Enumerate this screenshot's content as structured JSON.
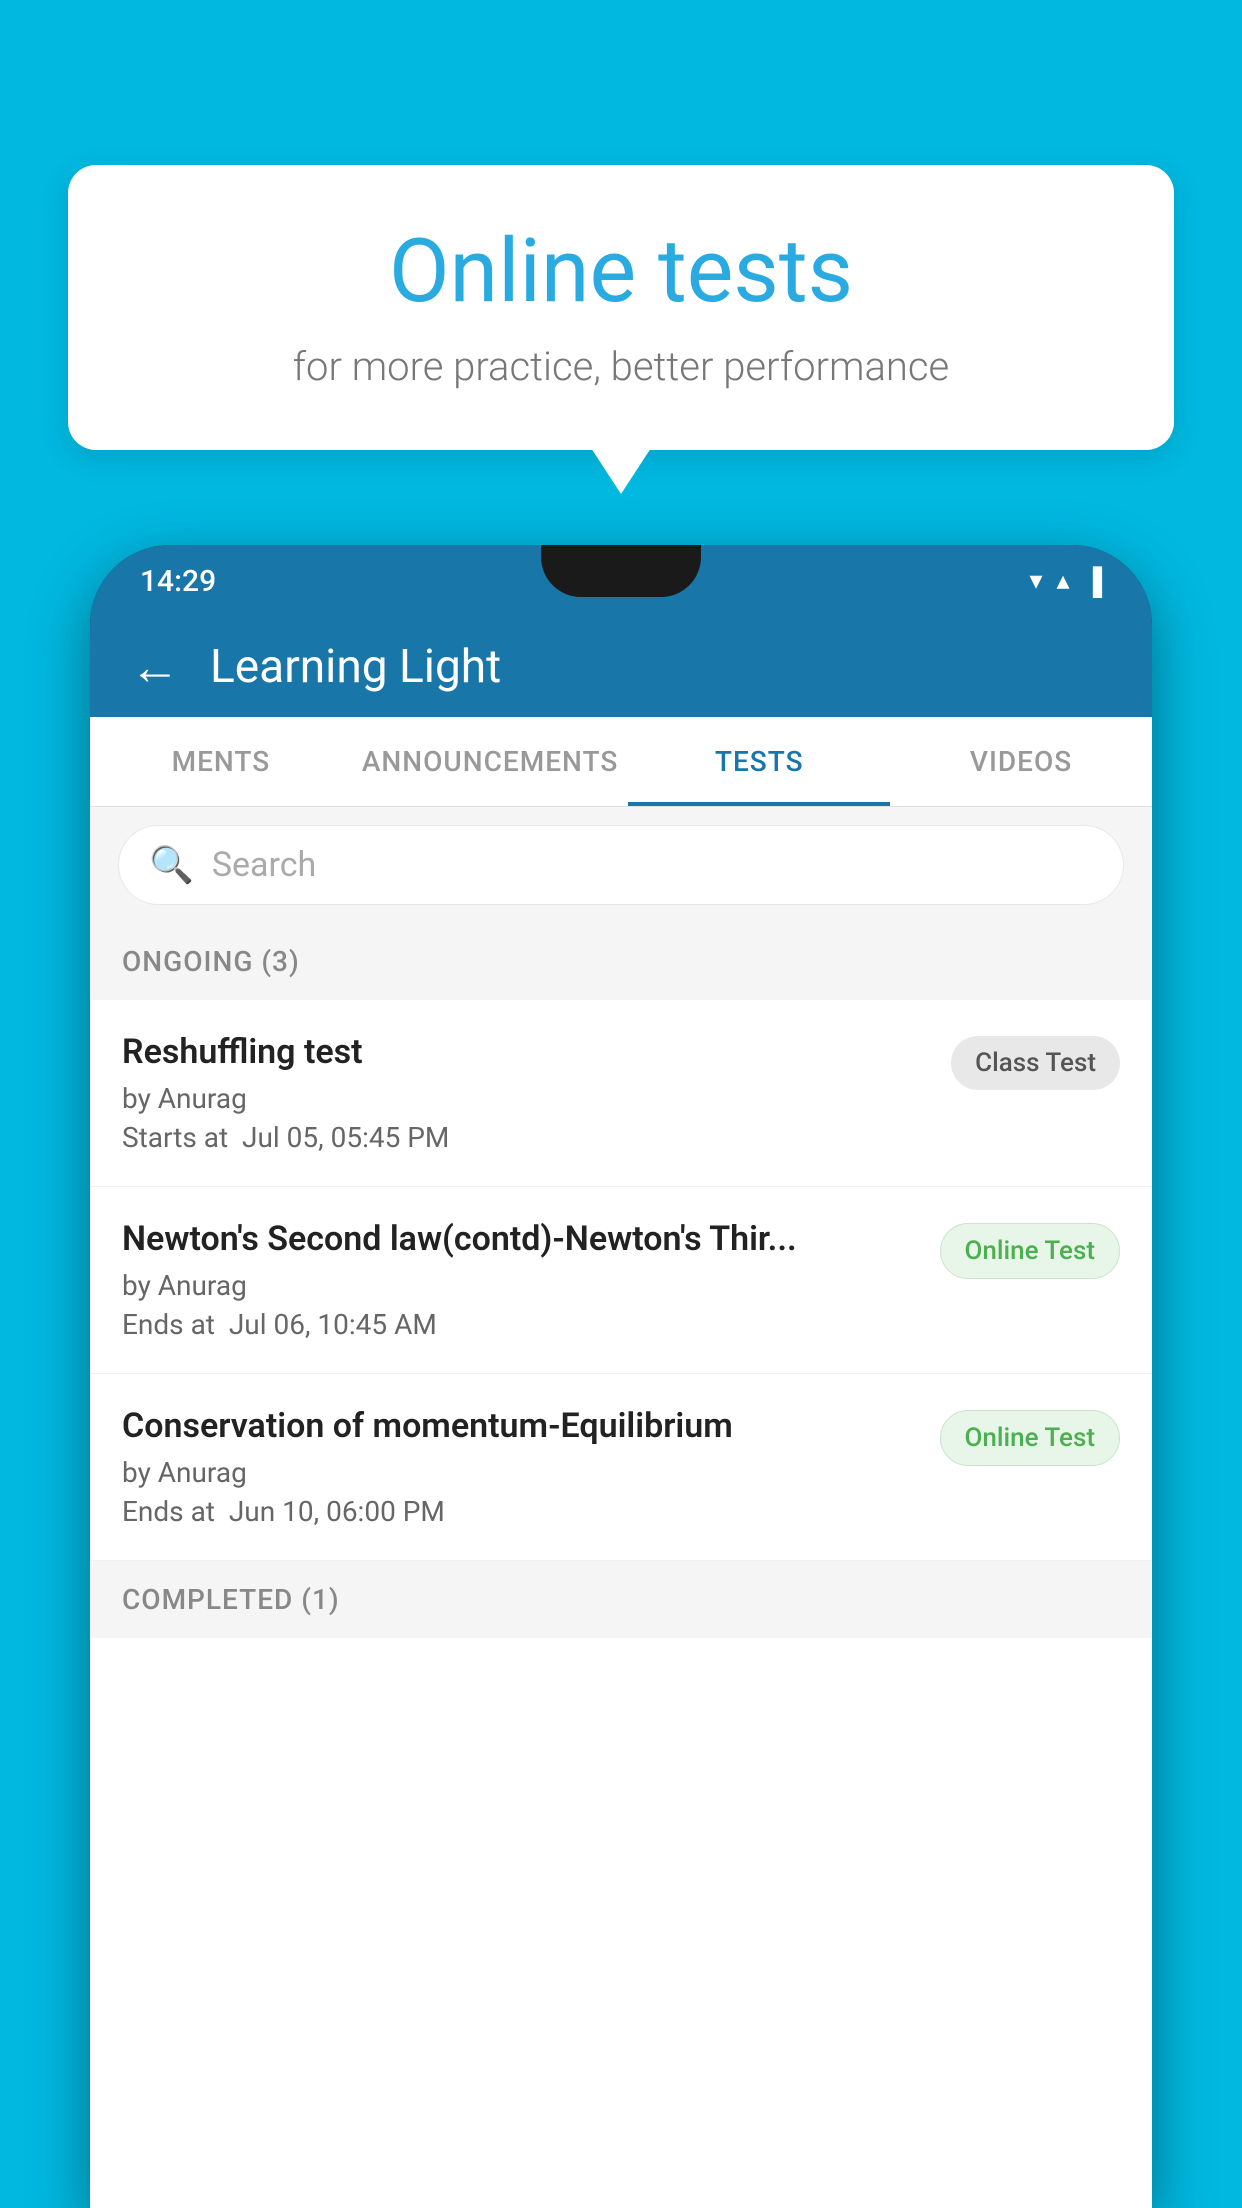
{
  "background_color": "#00b8e0",
  "bubble": {
    "title": "Online tests",
    "subtitle": "for more practice, better performance"
  },
  "status_bar": {
    "time": "14:29",
    "icons": [
      "▼",
      "▲",
      "▐"
    ]
  },
  "app_bar": {
    "back_label": "←",
    "title": "Learning Light"
  },
  "tabs": [
    {
      "label": "MENTS",
      "active": false
    },
    {
      "label": "ANNOUNCEMENTS",
      "active": false
    },
    {
      "label": "TESTS",
      "active": true
    },
    {
      "label": "VIDEOS",
      "active": false
    }
  ],
  "search": {
    "placeholder": "Search"
  },
  "ongoing_section": {
    "label": "ONGOING (3)"
  },
  "tests": [
    {
      "title": "Reshuffling test",
      "author": "by Anurag",
      "date_label": "Starts at",
      "date": "Jul 05, 05:45 PM",
      "badge": "Class Test",
      "badge_type": "class"
    },
    {
      "title": "Newton's Second law(contd)-Newton's Thir...",
      "author": "by Anurag",
      "date_label": "Ends at",
      "date": "Jul 06, 10:45 AM",
      "badge": "Online Test",
      "badge_type": "online"
    },
    {
      "title": "Conservation of momentum-Equilibrium",
      "author": "by Anurag",
      "date_label": "Ends at",
      "date": "Jun 10, 06:00 PM",
      "badge": "Online Test",
      "badge_type": "online"
    }
  ],
  "completed_section": {
    "label": "COMPLETED (1)"
  }
}
